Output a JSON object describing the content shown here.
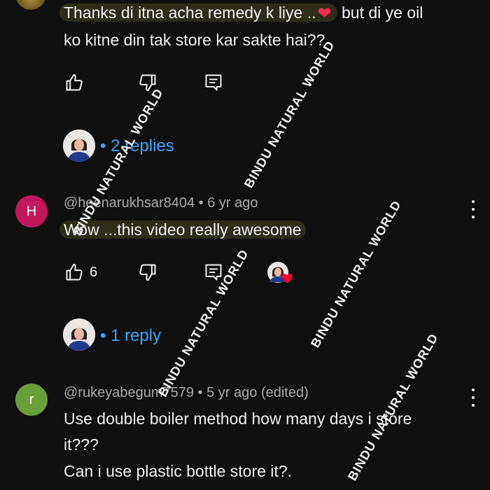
{
  "comments": [
    {
      "text_before_emoji": "Thanks di itna acha remedy k liye ..",
      "emoji": "❤",
      "text_after_emoji": " but di ye oil",
      "text_line2": "ko kitne din tak store kar sakte hai??",
      "replies_label": "2 replies"
    },
    {
      "avatar_letter": "H",
      "avatar_color": "#c2185b",
      "author": "@heenarukhsar8404",
      "time": "6 yr ago",
      "text": "Wow ...this video really awesome",
      "like_count": "6",
      "replies_label": "1 reply"
    },
    {
      "avatar_letter": "r",
      "avatar_color": "#689f38",
      "author": "@rukeyabegum7579",
      "time": "5 yr ago (edited)",
      "text_lines": [
        "Use double boiler method how many days i store",
        "it???",
        "Can i use plastic bottle store it?."
      ]
    }
  ],
  "meta_separator": "•",
  "reply_bullet": "•",
  "watermark": "BINDU NATURAL WORLD",
  "icons": {
    "like": "thumb-up-icon",
    "dislike": "thumb-down-icon",
    "reply": "comment-reply-icon",
    "more": "more-vertical-icon",
    "creator_heart": "heart-icon"
  },
  "colors": {
    "background": "#0f0f0f",
    "text": "#f1f1f1",
    "meta": "#aaaaaa",
    "link": "#3ea6ff",
    "heart": "#ff0033"
  }
}
